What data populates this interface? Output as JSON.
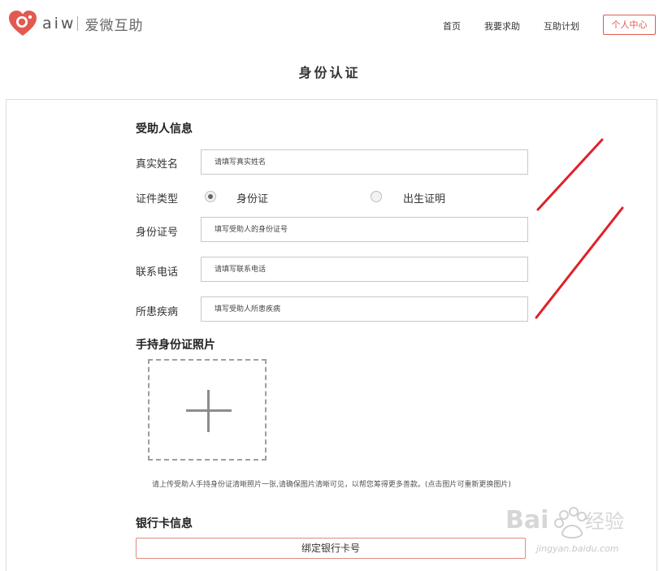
{
  "header": {
    "logo_latin": "aiw",
    "logo_cn": "爱微互助",
    "nav": {
      "home": "首页",
      "help": "我要求助",
      "plan": "互助计划",
      "user_center": "个人中心"
    }
  },
  "page_title": "身份认证",
  "recipient": {
    "section_title": "受助人信息",
    "name": {
      "label": "真实姓名",
      "placeholder": "请填写真实姓名",
      "value": ""
    },
    "id_type": {
      "label": "证件类型",
      "options": [
        {
          "label": "身份证",
          "selected": true
        },
        {
          "label": "出生证明",
          "selected": false
        }
      ]
    },
    "id_number": {
      "label": "身份证号",
      "placeholder": "填写受助人的身份证号",
      "value": ""
    },
    "phone": {
      "label": "联系电话",
      "placeholder": "请填写联系电话",
      "value": ""
    },
    "illness": {
      "label": "所患疾病",
      "placeholder": "填写受助人所患疾病",
      "value": ""
    }
  },
  "photo": {
    "section_title": "手持身份证照片",
    "upload_icon": "plus-icon",
    "hint": "请上传受助人手持身份证清晰照片一张,请确保图片清晰可见，以帮您筹得更多善款。(点击图片可重新更换图片)"
  },
  "bank": {
    "section_title": "银行卡信息",
    "bind_button": "绑定银行卡号"
  },
  "watermark": {
    "brand": "Baidu经验",
    "url": "jingyan.baidu.com"
  },
  "colors": {
    "accent": "#e25a4f",
    "annotation": "#e0202a"
  }
}
